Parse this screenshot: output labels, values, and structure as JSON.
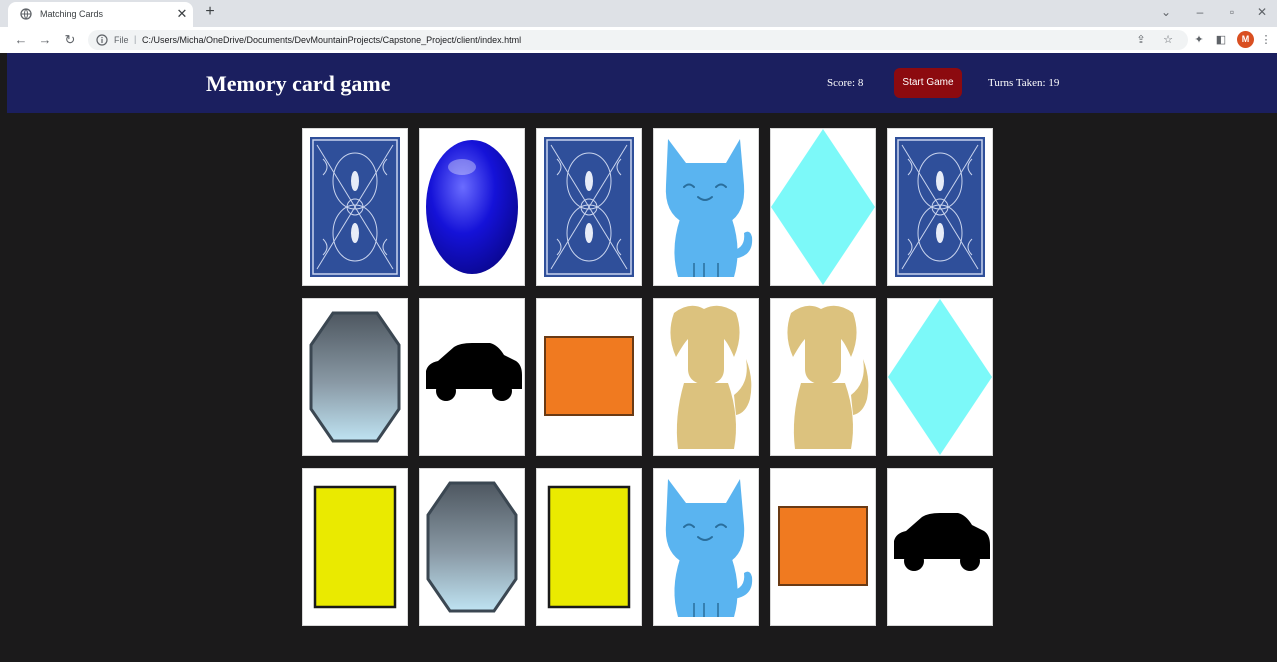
{
  "browser": {
    "tab_title": "Matching Cards",
    "tab_close": "✕",
    "new_tab": "+",
    "url_scheme": "File",
    "url_separator": "|",
    "url": "C:/Users/Micha/OneDrive/Documents/DevMountainProjects/Capstone_Project/client/index.html",
    "profile_initial": "M"
  },
  "header": {
    "title": "Memory card game",
    "score": "Score: 8",
    "start_button": "Start Game",
    "turns": "Turns Taken: 19"
  },
  "colors": {
    "header_bg": "#1b1f5f",
    "start_button_bg": "#8c0a0f",
    "page_bg": "#1b1a1b"
  },
  "cards": [
    [
      "card-back",
      "blue-oval",
      "card-back",
      "blue-cat",
      "cyan-diamond",
      "card-back"
    ],
    [
      "gray-octagon",
      "black-car",
      "orange-square",
      "tan-dog",
      "tan-dog",
      "cyan-diamond"
    ],
    [
      "yellow-rectangle",
      "gray-octagon",
      "yellow-rectangle",
      "blue-cat",
      "orange-square",
      "black-car"
    ]
  ]
}
